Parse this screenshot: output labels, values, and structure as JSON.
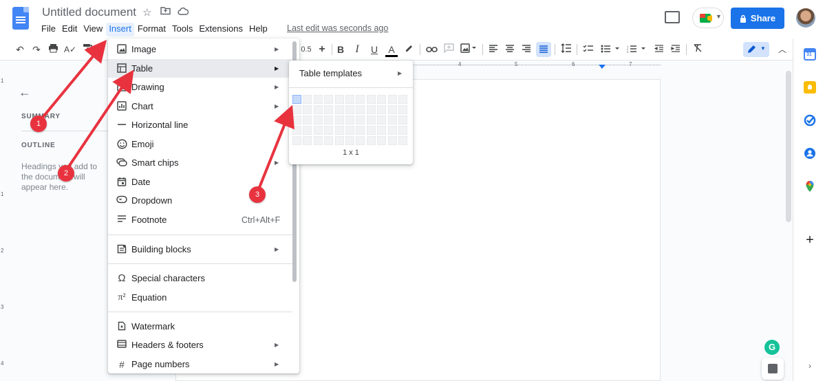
{
  "app": {
    "doc_title": "Untitled document",
    "last_edit": "Last edit was seconds ago",
    "share_label": "Share"
  },
  "menubar": [
    "File",
    "Edit",
    "View",
    "Insert",
    "Format",
    "Tools",
    "Extensions",
    "Help"
  ],
  "toolbar": {
    "font_size": "0.5"
  },
  "ruler": {
    "numbers": [
      "4",
      "5",
      "6",
      "7"
    ]
  },
  "vruler": {
    "numbers": [
      "1",
      "1",
      "2",
      "3",
      "4"
    ]
  },
  "outline_panel": {
    "summary_label": "SUMMARY",
    "outline_label": "OUTLINE",
    "hint": "Headings you add to the document will appear here."
  },
  "insert_menu": {
    "items": [
      {
        "label": "Image",
        "icon": "image-icon",
        "submenu": true
      },
      {
        "label": "Table",
        "icon": "table-icon",
        "submenu": true,
        "highlighted": true
      },
      {
        "label": "Drawing",
        "icon": "drawing-icon",
        "submenu": true
      },
      {
        "label": "Chart",
        "icon": "chart-icon",
        "submenu": true
      },
      {
        "label": "Horizontal line",
        "icon": "horizontal-line-icon",
        "submenu": false
      },
      {
        "label": "Emoji",
        "icon": "emoji-icon",
        "submenu": false
      },
      {
        "label": "Smart chips",
        "icon": "smart-chips-icon",
        "submenu": true
      },
      {
        "label": "Date",
        "icon": "date-icon",
        "submenu": false
      },
      {
        "label": "Dropdown",
        "icon": "dropdown-icon",
        "submenu": false
      },
      {
        "label": "Footnote",
        "icon": "footnote-icon",
        "submenu": false,
        "shortcut": "Ctrl+Alt+F"
      },
      {
        "label": "Building blocks",
        "icon": "building-blocks-icon",
        "submenu": true
      },
      {
        "label": "Special characters",
        "icon": "omega-icon",
        "submenu": false
      },
      {
        "label": "Equation",
        "icon": "pi-icon",
        "submenu": false
      },
      {
        "label": "Watermark",
        "icon": "watermark-icon",
        "submenu": false
      },
      {
        "label": "Headers & footers",
        "icon": "headers-footers-icon",
        "submenu": true
      },
      {
        "label": "Page numbers",
        "icon": "page-numbers-icon",
        "submenu": true
      }
    ]
  },
  "table_submenu": {
    "templates_label": "Table templates",
    "grid_rows": 5,
    "grid_cols": 11,
    "selected": "1 x 1"
  },
  "annotations": [
    "1",
    "2",
    "3"
  ],
  "colors": {
    "accent": "#1a73e8",
    "annotation_red": "#e8333f"
  }
}
